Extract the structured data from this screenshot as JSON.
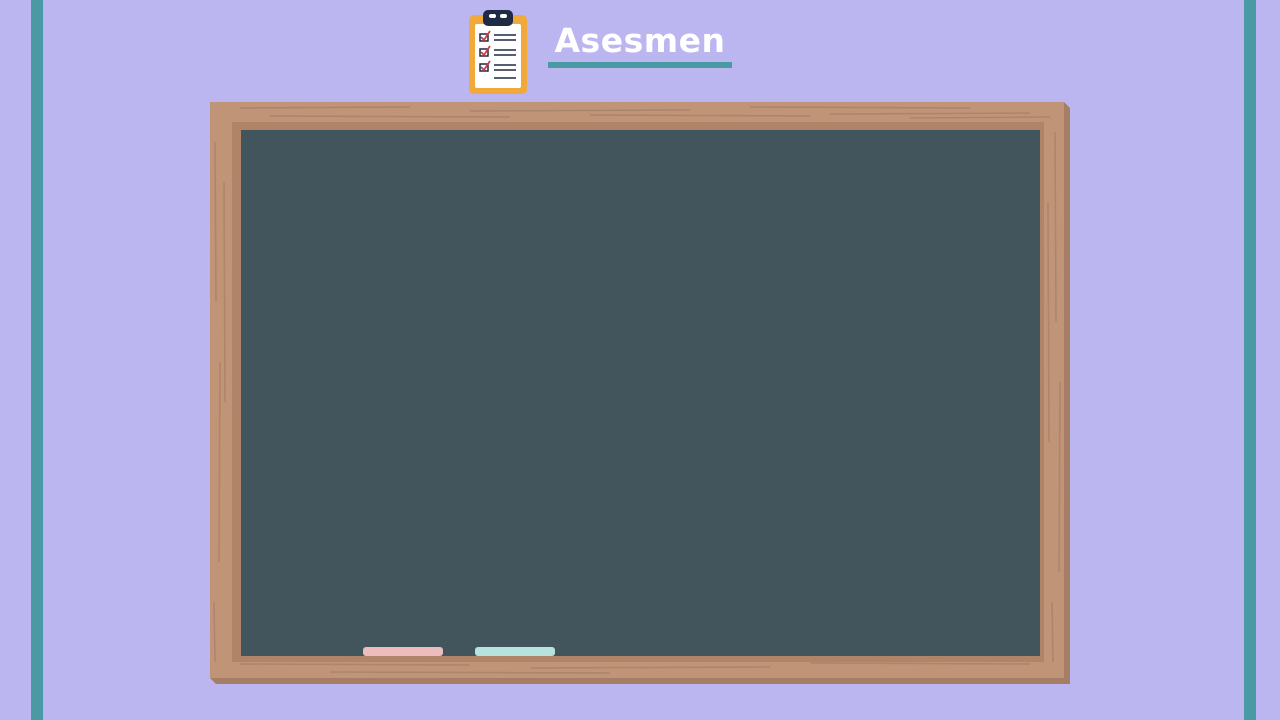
{
  "page": {
    "title": "Asesmen"
  },
  "colors": {
    "background": "#bbb5f0",
    "accent_teal": "#4a9aa6",
    "board": "#42545c",
    "frame_wood": "#c09476",
    "clipboard_orange": "#f0a93a",
    "chalk_pink": "#edbcbc",
    "chalk_mint": "#b7e3df"
  },
  "icons": {
    "header": "clipboard-checklist-icon"
  }
}
